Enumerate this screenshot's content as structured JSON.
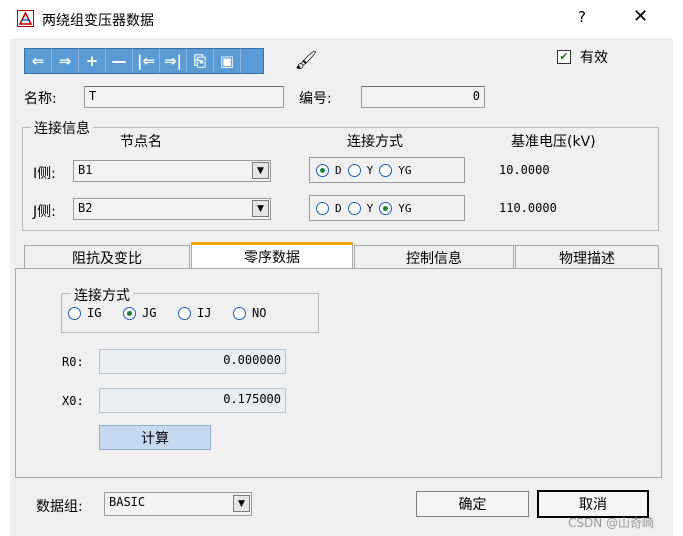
{
  "window": {
    "title": "两绕组变压器数据",
    "help": "?",
    "close": "✕"
  },
  "toolbar": {
    "buttons": [
      "⇐",
      "⇒",
      "+",
      "—",
      "|⇐",
      "⇒|",
      "⎘",
      "▣"
    ],
    "brush_icon": "🖌"
  },
  "valid": {
    "label": "有效",
    "checked": "✔"
  },
  "name": {
    "label": "名称:",
    "value": "T"
  },
  "number": {
    "label": "编号:",
    "value": "0"
  },
  "connection": {
    "group_title": "连接信息",
    "col_node": "节点名",
    "col_method": "连接方式",
    "col_voltage": "基准电压(kV)",
    "rows": [
      {
        "label": "I侧:",
        "node": "B1",
        "selected": "D",
        "voltage": "10.0000"
      },
      {
        "label": "J侧:",
        "node": "B2",
        "selected": "YG",
        "voltage": "110.0000"
      }
    ],
    "options": [
      "D",
      "Y",
      "YG"
    ]
  },
  "tabs": [
    "阻抗及变比",
    "零序数据",
    "控制信息",
    "物理描述"
  ],
  "active_tab": "零序数据",
  "zero_seq": {
    "group_title": "连接方式",
    "options": [
      "IG",
      "JG",
      "IJ",
      "NO"
    ],
    "selected": "JG",
    "r0_label": "R0:",
    "r0_value": "0.000000",
    "x0_label": "X0:",
    "x0_value": "0.175000",
    "calc_button": "计算"
  },
  "footer": {
    "group_label": "数据组:",
    "group_value": "BASIC",
    "ok_button": "确定",
    "cancel_button": "取消"
  },
  "watermark": "CSDN @山奇崎"
}
